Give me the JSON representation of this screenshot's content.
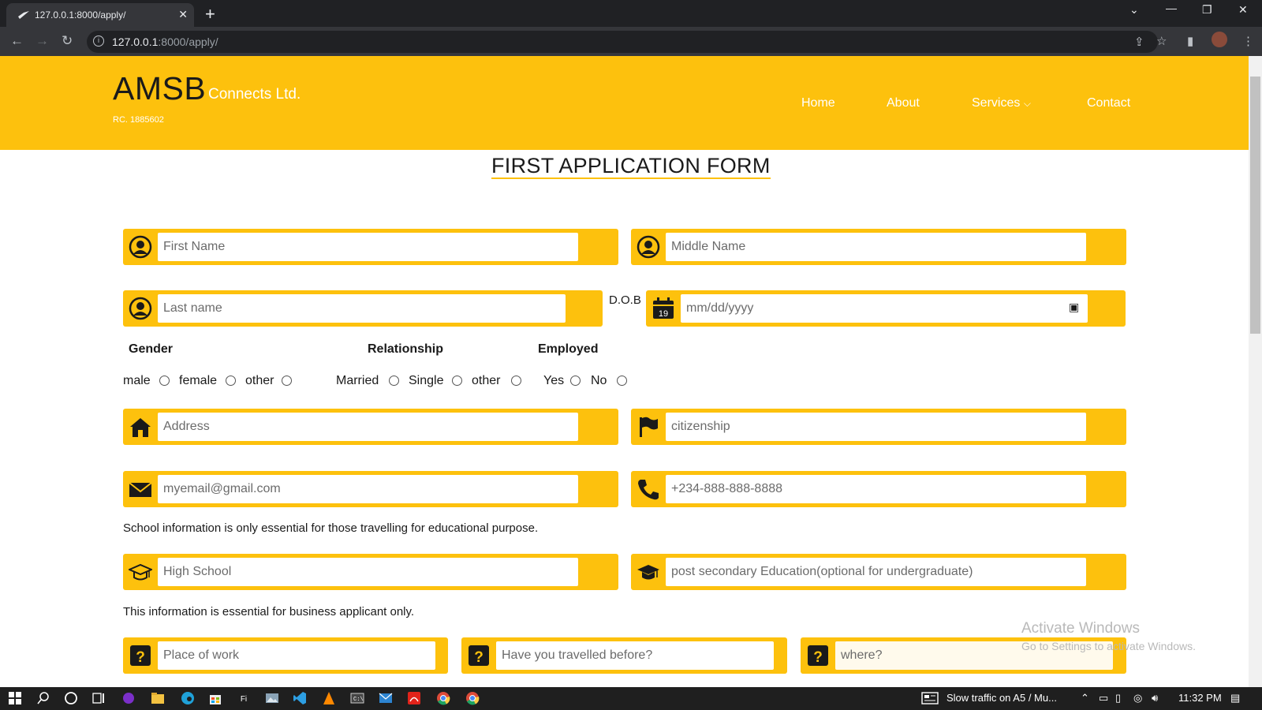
{
  "browser": {
    "tab_title": "127.0.0.1:8000/apply/",
    "url_host": "127.0.0.1",
    "url_path": ":8000/apply/"
  },
  "site": {
    "brand": "AMSB",
    "brand_sub": "Connects Ltd.",
    "rc": "RC. 1885602",
    "nav": [
      "Home",
      "About",
      "Services",
      "Contact"
    ],
    "colors": {
      "accent": "#fdc10d"
    }
  },
  "form": {
    "title": "FIRST APPLICATION FORM",
    "first_name_placeholder": "First Name",
    "middle_name_placeholder": "Middle Name",
    "last_name_placeholder": "Last name",
    "dob_label": "D.O.B",
    "dob_placeholder": "mm/dd/yyyy",
    "calendar_day": "19",
    "gender_label": "Gender",
    "gender_options": [
      "male",
      "female",
      "other"
    ],
    "relationship_label": "Relationship",
    "relationship_options": [
      "Married",
      "Single",
      "other"
    ],
    "employed_label": "Employed",
    "employed_options": [
      "Yes",
      "No"
    ],
    "address_placeholder": "Address",
    "citizenship_placeholder": "citizenship",
    "email_placeholder": "myemail@gmail.com",
    "phone_placeholder": "+234-888-888-8888",
    "school_note": "School information is only essential for those travelling for educational purpose.",
    "high_school_placeholder": "High School",
    "post_secondary_placeholder": "post secondary Education(optional for undergraduate)",
    "business_note": "This information is essential for business applicant only.",
    "place_of_work_placeholder": "Place of work",
    "travelled_placeholder": "Have you travelled before?",
    "where_placeholder": "where?"
  },
  "watermark": {
    "line1": "Activate Windows",
    "line2": "Go to Settings to activate Windows."
  },
  "taskbar": {
    "news": "Slow traffic on A5 / Mu...",
    "time": "11:32 PM"
  }
}
